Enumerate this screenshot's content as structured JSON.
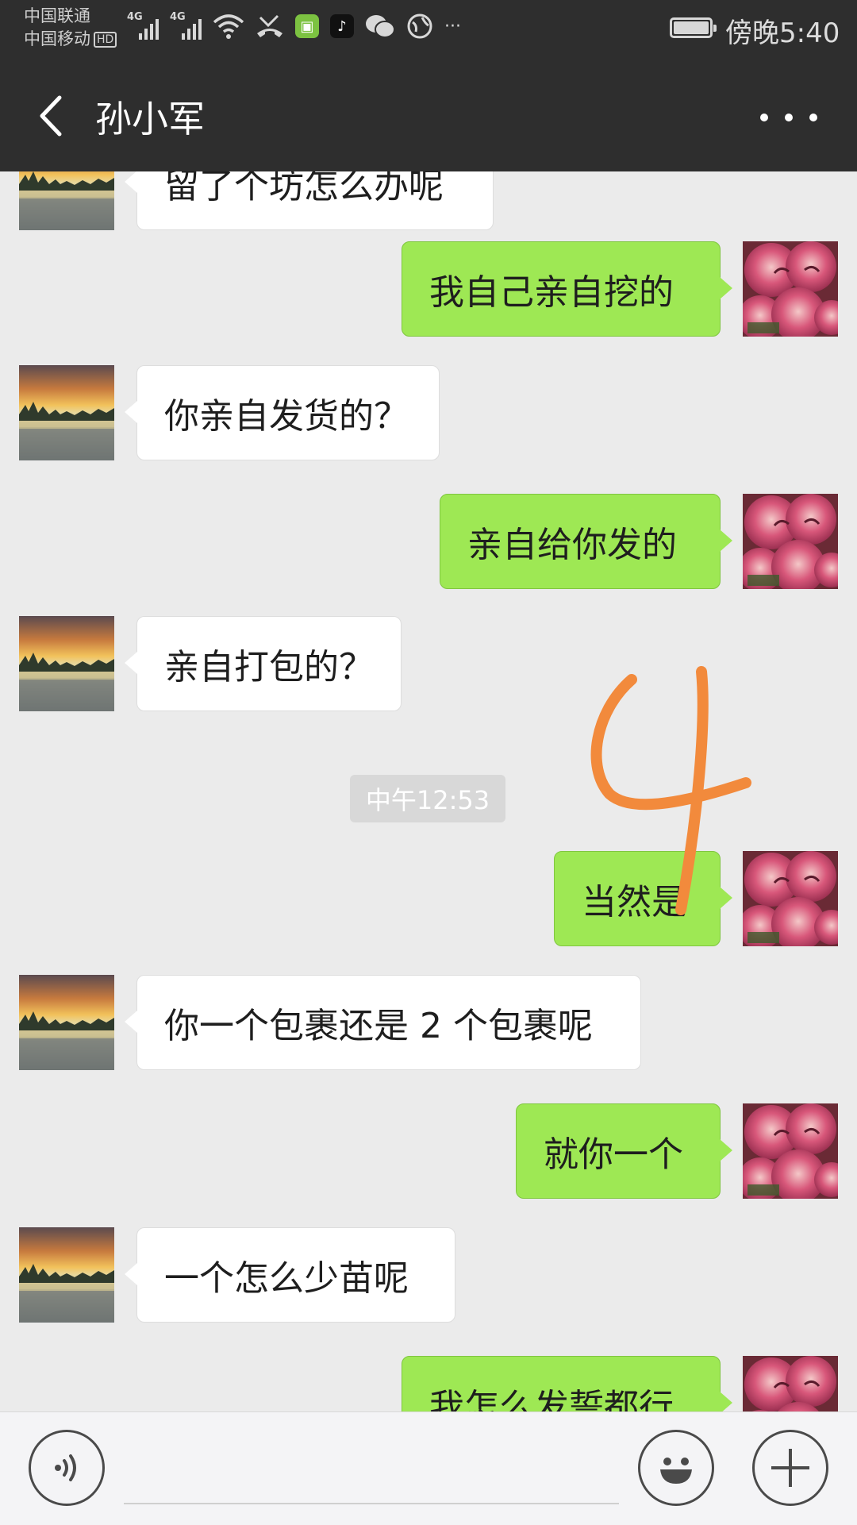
{
  "status_bar": {
    "carrier_1": "中国联通",
    "carrier_2": "中国移动",
    "hd_badge": "HD",
    "net_1": "4G",
    "net_2": "4G",
    "time": "傍晚5:40",
    "more_notifications": "···",
    "icons": [
      "signal-icon",
      "signal-icon",
      "wifi-icon",
      "missed-call-icon",
      "app-notification-icon",
      "tiktok-icon",
      "wechat-icon",
      "globe-icon",
      "battery-icon"
    ]
  },
  "header": {
    "title": "孙小军",
    "back_icon": "back-arrow-icon",
    "menu_icon": "more-dots-icon"
  },
  "messages": [
    {
      "side": "left",
      "text": "留了个坊怎么办呢",
      "partial": true
    },
    {
      "side": "right",
      "text": "我自己亲自挖的"
    },
    {
      "side": "left",
      "text": "你亲自发货的？"
    },
    {
      "side": "right",
      "text": "亲自给你发的"
    },
    {
      "side": "left",
      "text": "亲自打包的？"
    },
    {
      "side": "time",
      "text": "中午12:53"
    },
    {
      "side": "right",
      "text": "当然是"
    },
    {
      "side": "left",
      "text": "你一个包裹还是 2 个包裹呢"
    },
    {
      "side": "right",
      "text": "就你一个"
    },
    {
      "side": "left",
      "text": "一个怎么少苗呢"
    },
    {
      "side": "right",
      "text": "我怎么发誓都行",
      "partial": true
    }
  ],
  "annotation": {
    "text": "4",
    "color": "#f28a3c"
  },
  "avatars": {
    "contact": "sunset-lake-avatar",
    "self": "peach-fruit-avatar",
    "self_caption_1": "河南国豪苗新兴桃园",
    "self_caption_2": "13837624718"
  },
  "input_bar": {
    "voice_icon": "voice-icon",
    "emoji_icon": "emoji-icon",
    "plus_icon": "plus-icon"
  },
  "colors": {
    "bar_bg": "#2e2e2e",
    "chat_bg": "#ebebeb",
    "sent_bubble": "#9ee854",
    "received_bubble": "#ffffff",
    "timestamp_bg": "#d8d8d8"
  }
}
